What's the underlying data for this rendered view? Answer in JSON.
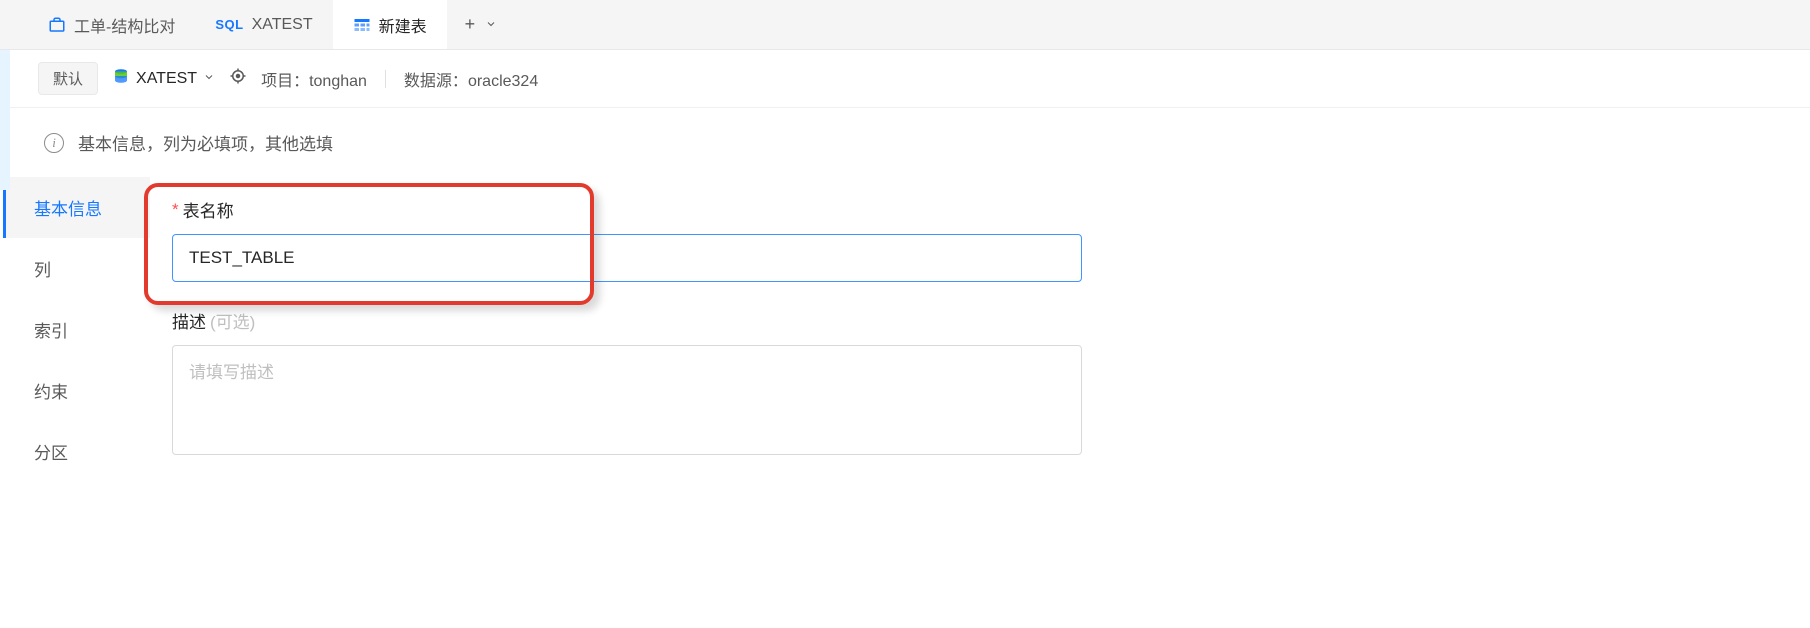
{
  "tabs": [
    {
      "icon": "work-order-icon",
      "label": "工单-结构比对"
    },
    {
      "icon": "sql-icon",
      "label": "XATEST"
    },
    {
      "icon": "table-icon",
      "label": "新建表"
    }
  ],
  "active_tab_index": 2,
  "context": {
    "default_button": "默认",
    "database_name": "XATEST",
    "project_label": "项目：",
    "project_value": "tonghan",
    "datasource_label": "数据源：",
    "datasource_value": "oracle324"
  },
  "info_banner": "基本信息，列为必填项，其他选填",
  "sidebar": {
    "items": [
      {
        "label": "基本信息"
      },
      {
        "label": "列"
      },
      {
        "label": "索引"
      },
      {
        "label": "约束"
      },
      {
        "label": "分区"
      }
    ],
    "active_index": 0
  },
  "form": {
    "table_name_label": "表名称",
    "table_name_value": "TEST_TABLE",
    "description_label": "描述",
    "description_optional": "(可选)",
    "description_placeholder": "请填写描述",
    "description_value": ""
  },
  "colors": {
    "accent": "#1677ff",
    "highlight_border": "#e23b2e"
  }
}
